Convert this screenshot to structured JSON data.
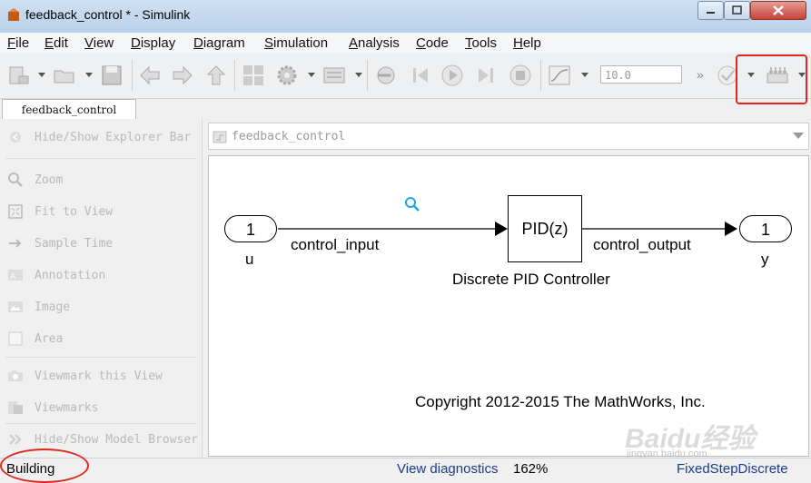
{
  "window": {
    "title": "feedback_control * - Simulink"
  },
  "menu": [
    {
      "label": "File",
      "mnemonic": "F"
    },
    {
      "label": "Edit",
      "mnemonic": "E"
    },
    {
      "label": "View",
      "mnemonic": "V"
    },
    {
      "label": "Display",
      "mnemonic": "D"
    },
    {
      "label": "Diagram",
      "mnemonic": "D"
    },
    {
      "label": "Simulation",
      "mnemonic": "S"
    },
    {
      "label": "Analysis",
      "mnemonic": "A"
    },
    {
      "label": "Code",
      "mnemonic": "C"
    },
    {
      "label": "Tools",
      "mnemonic": "T"
    },
    {
      "label": "Help",
      "mnemonic": "H"
    }
  ],
  "toolbar": {
    "stop_time": "10.0",
    "overflow": "»"
  },
  "tab": {
    "label": "feedback_control"
  },
  "palette": {
    "items": [
      {
        "label": "Hide/Show Explorer Bar",
        "icon": "explorer-bar-icon"
      },
      {
        "label": "Zoom",
        "icon": "zoom-icon"
      },
      {
        "label": "Fit to View",
        "icon": "fit-to-view-icon"
      },
      {
        "label": "Sample Time",
        "icon": "sample-time-icon"
      },
      {
        "label": "Annotation",
        "icon": "annotation-icon"
      },
      {
        "label": "Image",
        "icon": "image-icon"
      },
      {
        "label": "Area",
        "icon": "area-icon"
      },
      {
        "label": "Viewmark this View",
        "icon": "camera-icon"
      },
      {
        "label": "Viewmarks",
        "icon": "viewmarks-icon"
      },
      {
        "label": "Hide/Show Model Browser",
        "icon": "model-browser-icon"
      }
    ]
  },
  "breadcrumb": {
    "path": "feedback_control"
  },
  "diagram": {
    "inport": {
      "number": "1",
      "name": "u"
    },
    "outport": {
      "number": "1",
      "name": "y"
    },
    "block": {
      "text": "PID(z)",
      "name": "Discrete PID Controller"
    },
    "signal_in": "control_input",
    "signal_out": "control_output",
    "copyright": "Copyright 2012-2015 The MathWorks, Inc."
  },
  "status": {
    "state": "Building",
    "diagnostics_link": "View diagnostics",
    "zoom": "162%",
    "solver": "FixedStepDiscrete"
  },
  "watermark": {
    "brand": "Baidu经验",
    "site": "jingyan.baidu.com"
  },
  "colors": {
    "highlight": "#e0261f",
    "link": "#1a3c8c"
  }
}
